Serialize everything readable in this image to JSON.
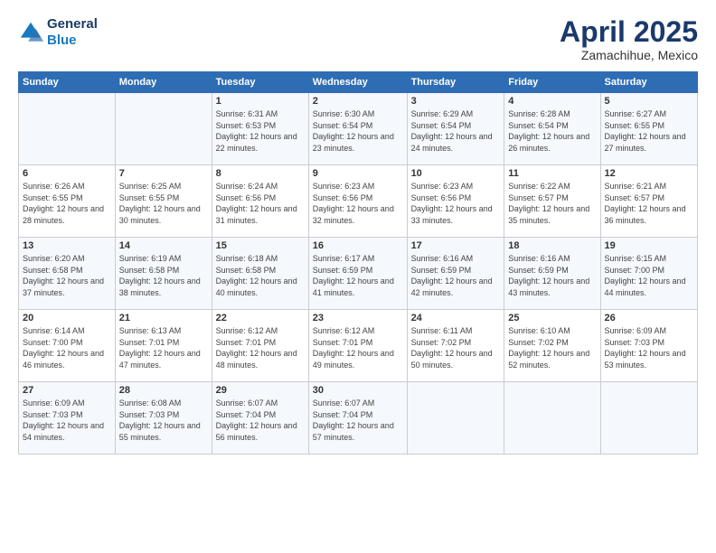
{
  "logo": {
    "line1": "General",
    "line2": "Blue"
  },
  "header": {
    "title": "April 2025",
    "subtitle": "Zamachihue, Mexico"
  },
  "weekdays": [
    "Sunday",
    "Monday",
    "Tuesday",
    "Wednesday",
    "Thursday",
    "Friday",
    "Saturday"
  ],
  "weeks": [
    [
      {
        "day": "",
        "sunrise": "",
        "sunset": "",
        "daylight": ""
      },
      {
        "day": "",
        "sunrise": "",
        "sunset": "",
        "daylight": ""
      },
      {
        "day": "1",
        "sunrise": "Sunrise: 6:31 AM",
        "sunset": "Sunset: 6:53 PM",
        "daylight": "Daylight: 12 hours and 22 minutes."
      },
      {
        "day": "2",
        "sunrise": "Sunrise: 6:30 AM",
        "sunset": "Sunset: 6:54 PM",
        "daylight": "Daylight: 12 hours and 23 minutes."
      },
      {
        "day": "3",
        "sunrise": "Sunrise: 6:29 AM",
        "sunset": "Sunset: 6:54 PM",
        "daylight": "Daylight: 12 hours and 24 minutes."
      },
      {
        "day": "4",
        "sunrise": "Sunrise: 6:28 AM",
        "sunset": "Sunset: 6:54 PM",
        "daylight": "Daylight: 12 hours and 26 minutes."
      },
      {
        "day": "5",
        "sunrise": "Sunrise: 6:27 AM",
        "sunset": "Sunset: 6:55 PM",
        "daylight": "Daylight: 12 hours and 27 minutes."
      }
    ],
    [
      {
        "day": "6",
        "sunrise": "Sunrise: 6:26 AM",
        "sunset": "Sunset: 6:55 PM",
        "daylight": "Daylight: 12 hours and 28 minutes."
      },
      {
        "day": "7",
        "sunrise": "Sunrise: 6:25 AM",
        "sunset": "Sunset: 6:55 PM",
        "daylight": "Daylight: 12 hours and 30 minutes."
      },
      {
        "day": "8",
        "sunrise": "Sunrise: 6:24 AM",
        "sunset": "Sunset: 6:56 PM",
        "daylight": "Daylight: 12 hours and 31 minutes."
      },
      {
        "day": "9",
        "sunrise": "Sunrise: 6:23 AM",
        "sunset": "Sunset: 6:56 PM",
        "daylight": "Daylight: 12 hours and 32 minutes."
      },
      {
        "day": "10",
        "sunrise": "Sunrise: 6:23 AM",
        "sunset": "Sunset: 6:56 PM",
        "daylight": "Daylight: 12 hours and 33 minutes."
      },
      {
        "day": "11",
        "sunrise": "Sunrise: 6:22 AM",
        "sunset": "Sunset: 6:57 PM",
        "daylight": "Daylight: 12 hours and 35 minutes."
      },
      {
        "day": "12",
        "sunrise": "Sunrise: 6:21 AM",
        "sunset": "Sunset: 6:57 PM",
        "daylight": "Daylight: 12 hours and 36 minutes."
      }
    ],
    [
      {
        "day": "13",
        "sunrise": "Sunrise: 6:20 AM",
        "sunset": "Sunset: 6:58 PM",
        "daylight": "Daylight: 12 hours and 37 minutes."
      },
      {
        "day": "14",
        "sunrise": "Sunrise: 6:19 AM",
        "sunset": "Sunset: 6:58 PM",
        "daylight": "Daylight: 12 hours and 38 minutes."
      },
      {
        "day": "15",
        "sunrise": "Sunrise: 6:18 AM",
        "sunset": "Sunset: 6:58 PM",
        "daylight": "Daylight: 12 hours and 40 minutes."
      },
      {
        "day": "16",
        "sunrise": "Sunrise: 6:17 AM",
        "sunset": "Sunset: 6:59 PM",
        "daylight": "Daylight: 12 hours and 41 minutes."
      },
      {
        "day": "17",
        "sunrise": "Sunrise: 6:16 AM",
        "sunset": "Sunset: 6:59 PM",
        "daylight": "Daylight: 12 hours and 42 minutes."
      },
      {
        "day": "18",
        "sunrise": "Sunrise: 6:16 AM",
        "sunset": "Sunset: 6:59 PM",
        "daylight": "Daylight: 12 hours and 43 minutes."
      },
      {
        "day": "19",
        "sunrise": "Sunrise: 6:15 AM",
        "sunset": "Sunset: 7:00 PM",
        "daylight": "Daylight: 12 hours and 44 minutes."
      }
    ],
    [
      {
        "day": "20",
        "sunrise": "Sunrise: 6:14 AM",
        "sunset": "Sunset: 7:00 PM",
        "daylight": "Daylight: 12 hours and 46 minutes."
      },
      {
        "day": "21",
        "sunrise": "Sunrise: 6:13 AM",
        "sunset": "Sunset: 7:01 PM",
        "daylight": "Daylight: 12 hours and 47 minutes."
      },
      {
        "day": "22",
        "sunrise": "Sunrise: 6:12 AM",
        "sunset": "Sunset: 7:01 PM",
        "daylight": "Daylight: 12 hours and 48 minutes."
      },
      {
        "day": "23",
        "sunrise": "Sunrise: 6:12 AM",
        "sunset": "Sunset: 7:01 PM",
        "daylight": "Daylight: 12 hours and 49 minutes."
      },
      {
        "day": "24",
        "sunrise": "Sunrise: 6:11 AM",
        "sunset": "Sunset: 7:02 PM",
        "daylight": "Daylight: 12 hours and 50 minutes."
      },
      {
        "day": "25",
        "sunrise": "Sunrise: 6:10 AM",
        "sunset": "Sunset: 7:02 PM",
        "daylight": "Daylight: 12 hours and 52 minutes."
      },
      {
        "day": "26",
        "sunrise": "Sunrise: 6:09 AM",
        "sunset": "Sunset: 7:03 PM",
        "daylight": "Daylight: 12 hours and 53 minutes."
      }
    ],
    [
      {
        "day": "27",
        "sunrise": "Sunrise: 6:09 AM",
        "sunset": "Sunset: 7:03 PM",
        "daylight": "Daylight: 12 hours and 54 minutes."
      },
      {
        "day": "28",
        "sunrise": "Sunrise: 6:08 AM",
        "sunset": "Sunset: 7:03 PM",
        "daylight": "Daylight: 12 hours and 55 minutes."
      },
      {
        "day": "29",
        "sunrise": "Sunrise: 6:07 AM",
        "sunset": "Sunset: 7:04 PM",
        "daylight": "Daylight: 12 hours and 56 minutes."
      },
      {
        "day": "30",
        "sunrise": "Sunrise: 6:07 AM",
        "sunset": "Sunset: 7:04 PM",
        "daylight": "Daylight: 12 hours and 57 minutes."
      },
      {
        "day": "",
        "sunrise": "",
        "sunset": "",
        "daylight": ""
      },
      {
        "day": "",
        "sunrise": "",
        "sunset": "",
        "daylight": ""
      },
      {
        "day": "",
        "sunrise": "",
        "sunset": "",
        "daylight": ""
      }
    ]
  ]
}
